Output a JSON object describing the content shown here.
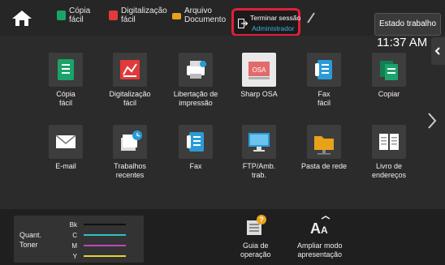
{
  "header": {
    "shortcuts": [
      {
        "label": "Cópia\nfácil",
        "icon": "copy-icon",
        "color": "#1aa36b"
      },
      {
        "label": "Digitalização\nfácil",
        "icon": "scan-icon",
        "color": "#e23a3a"
      },
      {
        "label": "Arquivo\nDocumento",
        "icon": "folder-icon",
        "color": "#e8a21a"
      }
    ],
    "logout": {
      "line1": "Terminar sessão",
      "line2": "Administrador",
      "accent": "#e0203a",
      "user_color": "#3bb0e6"
    },
    "status_button": "Estado trabalho",
    "time": "11:37 AM"
  },
  "apps_row1": [
    {
      "label": "Cópia\nfácil",
      "icon": "easy-copy-icon",
      "color": "#1aa36b"
    },
    {
      "label": "Digitalização\nfácil",
      "icon": "easy-scan-icon",
      "color": "#e23a3a"
    },
    {
      "label": "Libertação de\nimpressão",
      "icon": "print-release-icon",
      "color": "#ffffff"
    },
    {
      "label": "Sharp OSA",
      "icon": "sharp-osa-icon",
      "color": "#e36a6a",
      "badge": "OSA"
    },
    {
      "label": "Fax\nfácil",
      "icon": "easy-fax-icon",
      "color": "#2a9bd8"
    },
    {
      "label": "Copiar",
      "icon": "copy-icon",
      "color": "#1aa36b"
    }
  ],
  "apps_row2": [
    {
      "label": "E-mail",
      "icon": "email-icon",
      "color": "#ffffff"
    },
    {
      "label": "Trabalhos\nrecentes",
      "icon": "recent-jobs-icon",
      "color": "#ffffff"
    },
    {
      "label": "Fax",
      "icon": "fax-icon",
      "color": "#2a9bd8"
    },
    {
      "label": "FTP/Amb.\ntrab.",
      "icon": "ftp-desktop-icon",
      "color": "#2a9bd8"
    },
    {
      "label": "Pasta de rede",
      "icon": "network-folder-icon",
      "color": "#e8a21a"
    },
    {
      "label": "Livro de\nendereços",
      "icon": "address-book-icon",
      "color": "#ffffff"
    }
  ],
  "toner": {
    "title": "Quant.\nToner",
    "rows": [
      {
        "label": "Bk",
        "color": "#111111"
      },
      {
        "label": "C",
        "color": "#2fbfc7"
      },
      {
        "label": "M",
        "color": "#c044c0"
      },
      {
        "label": "Y",
        "color": "#e2d23a"
      }
    ]
  },
  "bottom_buttons": [
    {
      "label": "Guia de\noperação",
      "icon": "operation-guide-icon"
    },
    {
      "label": "Ampliar modo\napresentação",
      "icon": "enlarge-display-icon"
    }
  ]
}
